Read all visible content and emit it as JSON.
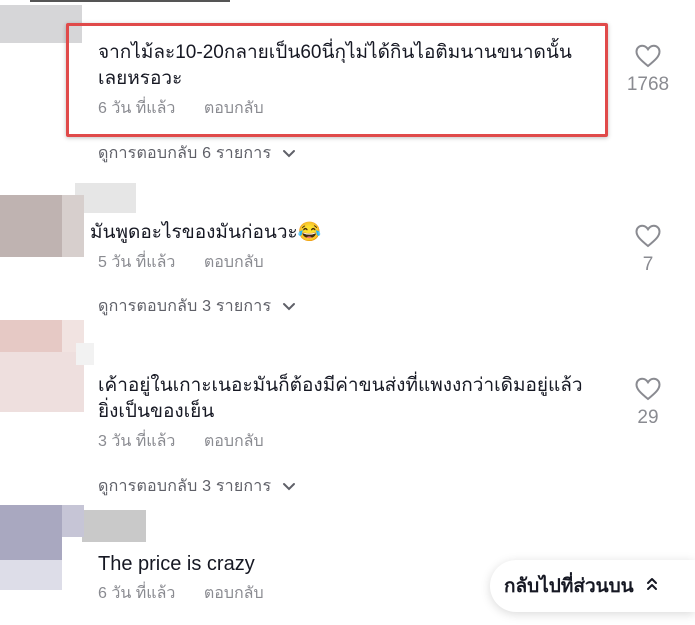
{
  "comments": [
    {
      "text": "จากไม้ละ10-20กลายเป็น60นี่กุไม่ได้กินไอติมนานขนาดนั้นเลยหรอวะ",
      "time": "6 วัน ที่แล้ว",
      "reply_label": "ตอบกลับ",
      "view_replies": "ดูการตอบกลับ 6 รายการ",
      "likes": "1768"
    },
    {
      "text": "มันพูดอะไรของมันก่อนวะ😂",
      "time": "5 วัน ที่แล้ว",
      "reply_label": "ตอบกลับ",
      "view_replies": "ดูการตอบกลับ 3 รายการ",
      "likes": "7"
    },
    {
      "text": "เค้าอยู่ในเกาะเนอะมันก็ต้องมีค่าขนส่งที่แพงงกว่าเดิมอยู่แล้ว ยิ่งเป็นของเย็น",
      "time": "3 วัน ที่แล้ว",
      "reply_label": "ตอบกลับ",
      "view_replies": "ดูการตอบกลับ 3 รายการ",
      "likes": "29"
    },
    {
      "text": "The price is crazy",
      "time": "6 วัน ที่แล้ว",
      "reply_label": "ตอบกลับ"
    }
  ],
  "back_to_top": {
    "label": "กลับไปที่ส่วนบน"
  },
  "icons": {
    "like": "heart-outline-icon",
    "expand": "chevron-down-icon",
    "back_to_top": "double-chevron-up-icon"
  },
  "colors": {
    "highlight": "#e04a4a",
    "meta": "#8a8b91",
    "text": "#161823"
  }
}
